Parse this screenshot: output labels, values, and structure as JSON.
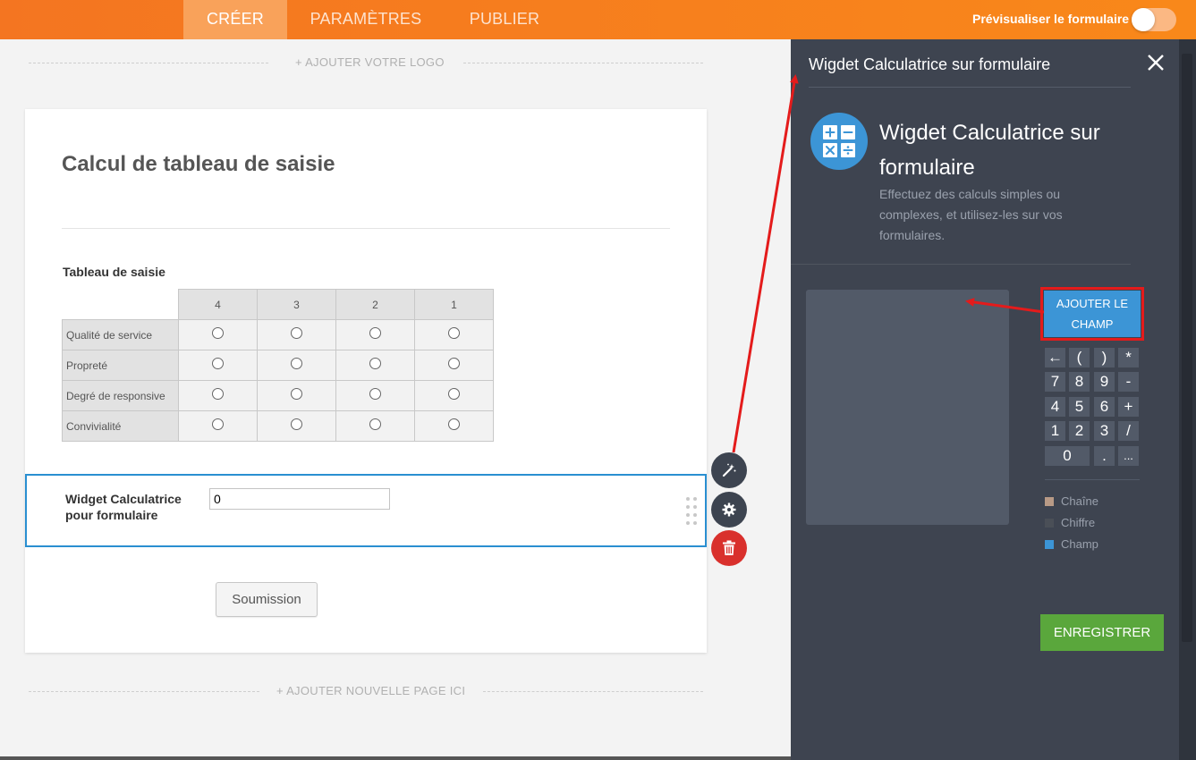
{
  "topbar": {
    "tabs": [
      {
        "label": "CRÉER"
      },
      {
        "label": "PARAMÈTRES"
      },
      {
        "label": "PUBLIER"
      }
    ],
    "preview_label": "Prévisualiser le formulaire"
  },
  "builder": {
    "add_logo": "+ AJOUTER VOTRE LOGO",
    "add_page": "+ AJOUTER NOUVELLE PAGE ICI"
  },
  "form": {
    "title": "Calcul de tableau de saisie",
    "matrix": {
      "label": "Tableau de saisie",
      "columns": [
        "4",
        "3",
        "2",
        "1"
      ],
      "rows": [
        "Qualité de service",
        "Propreté",
        "Degré de responsive",
        "Convivialité"
      ]
    },
    "widget": {
      "label": "Widget Calculatrice pour formulaire",
      "value": "0"
    },
    "submit_label": "Soumission"
  },
  "panel": {
    "title": "Wigdet Calculatrice sur formulaire",
    "widget_name": "Wigdet Calculatrice sur formulaire",
    "description": "Effectuez des calculs simples ou complexes, et utilisez-les sur vos formulaires.",
    "add_field_label": "AJOUTER LE CHAMP",
    "keypad": [
      [
        "←",
        "(",
        ")",
        "*"
      ],
      [
        "7",
        "8",
        "9",
        "-"
      ],
      [
        "4",
        "5",
        "6",
        "+"
      ],
      [
        "1",
        "2",
        "3",
        "/"
      ],
      [
        "0",
        ".",
        "..."
      ]
    ],
    "legend": [
      {
        "label": "Chaîne",
        "color": "#b89a86"
      },
      {
        "label": "Chiffre",
        "color": "#4a4f57"
      },
      {
        "label": "Champ",
        "color": "#3c95d6"
      }
    ],
    "save_label": "ENREGISTRER"
  },
  "colors": {
    "topbar": "#f57c1b",
    "panel": "#3e4450",
    "accent_blue": "#3c95d6",
    "save_green": "#5aa73c",
    "highlight_red": "#e41b1b"
  }
}
